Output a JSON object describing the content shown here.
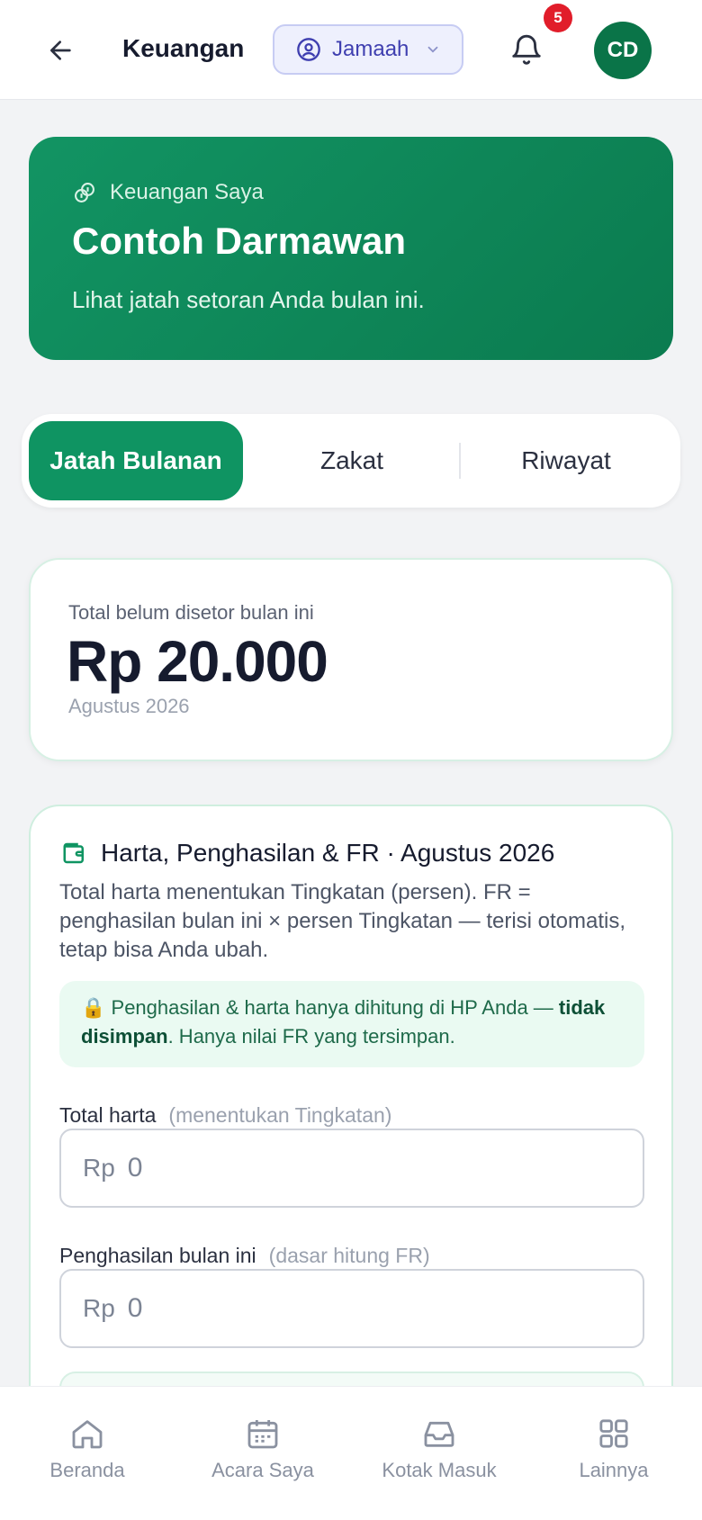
{
  "header": {
    "title": "Keuangan",
    "role_label": "Jamaah",
    "notification_count": "5",
    "avatar_initials": "CD"
  },
  "hero": {
    "eyebrow": "Keuangan Saya",
    "name": "Contoh Darmawan",
    "description": "Lihat jatah setoran Anda bulan ini."
  },
  "tabs": [
    {
      "label": "Jatah Bulanan",
      "active": true
    },
    {
      "label": "Zakat",
      "active": false
    },
    {
      "label": "Riwayat",
      "active": false
    }
  ],
  "summary": {
    "label": "Total belum disetor bulan ini",
    "amount": "Rp 20.000",
    "period": "Agustus 2026"
  },
  "form": {
    "title": "Harta, Penghasilan & FR · Agustus 2026",
    "description": "Total harta menentukan Tingkatan (persen). FR = penghasilan bulan ini × persen Tingkatan — terisi otomatis, tetap bisa Anda ubah.",
    "note_lock": "🔒",
    "note_text": " Penghasilan & harta hanya dihitung di HP Anda — ",
    "note_bold": "tidak disimpan",
    "note_tail": ". Hanya nilai FR yang tersimpan.",
    "fields": [
      {
        "label": "Total harta",
        "hint": "(menentukan Tingkatan)",
        "prefix": "Rp",
        "value": "0"
      },
      {
        "label": "Penghasilan bulan ini",
        "hint": "(dasar hitung FR)",
        "prefix": "Rp",
        "value": "0"
      }
    ]
  },
  "bottom_nav": [
    {
      "label": "Beranda",
      "icon": "home-icon"
    },
    {
      "label": "Acara Saya",
      "icon": "calendar-icon"
    },
    {
      "label": "Kotak Masuk",
      "icon": "inbox-icon"
    },
    {
      "label": "Lainnya",
      "icon": "grid-icon"
    }
  ],
  "colors": {
    "primary": "#0f9462",
    "badge": "#e11d2a",
    "role_accent": "#3f3fb0"
  }
}
